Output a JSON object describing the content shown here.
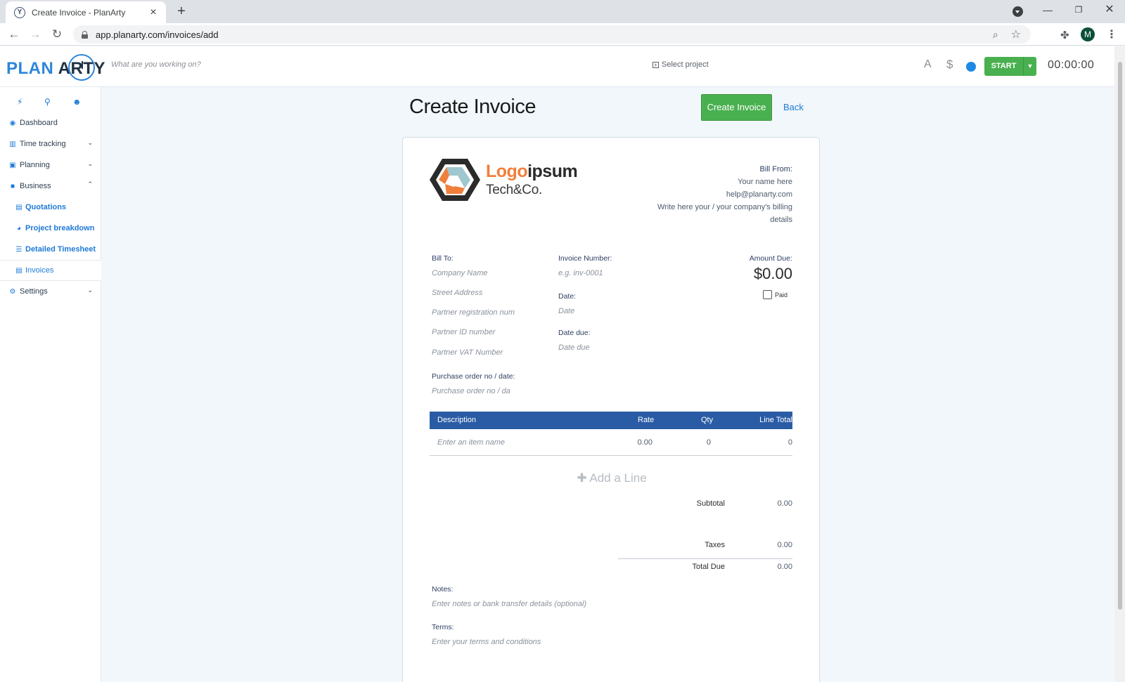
{
  "browser": {
    "tab_title": "Create Invoice - PlanArty",
    "favicon_letter": "Y",
    "url": "app.planarty.com/invoices/add",
    "profile_initial": "M"
  },
  "app": {
    "logo_plan": "PLAN",
    "logo_arty": "ARTY",
    "search_placeholder": "What are you working on?",
    "select_project": "Select project",
    "billable_icon_text": "A",
    "currency_icon_text": "$",
    "start_label": "START",
    "timer": "00:00:00"
  },
  "sidebar": {
    "quick_icons": [
      "bolt-icon",
      "search-icon",
      "user-cog-icon"
    ],
    "items": [
      {
        "label": "Dashboard",
        "icon": "dashboard-icon"
      },
      {
        "label": "Time tracking",
        "icon": "chart-icon"
      },
      {
        "label": "Planning",
        "icon": "calendar-icon"
      },
      {
        "label": "Business",
        "icon": "briefcase-icon"
      },
      {
        "label": "Quotations",
        "icon": "document-icon"
      },
      {
        "label": "Project breakdown",
        "icon": "pie-chart-icon"
      },
      {
        "label": "Detailed Timesheet",
        "icon": "list-icon"
      },
      {
        "label": "Invoices",
        "icon": "file-icon"
      },
      {
        "label": "Settings",
        "icon": "gear-icon"
      }
    ]
  },
  "page": {
    "title": "Create Invoice",
    "create_button": "Create Invoice",
    "back_link": "Back"
  },
  "invoice": {
    "logo_word_a": "Logo",
    "logo_word_b": "ipsum",
    "logo_sub": "Tech&Co.",
    "bill_from": {
      "label": "Bill From:",
      "name": "Your name here",
      "email": "help@planarty.com",
      "details": "Write here your / your company's billing details"
    },
    "bill_to": {
      "label": "Bill To:",
      "company": "Company Name",
      "street": "Street Address",
      "reg_num": "Partner registration num",
      "partner_id": "Partner ID number",
      "vat": "Partner VAT Number"
    },
    "invoice_number_label": "Invoice Number:",
    "invoice_number_placeholder": "e.g.   inv-0001",
    "date_label": "Date:",
    "date_placeholder": "Date",
    "date_due_label": "Date due:",
    "date_due_placeholder": "Date due",
    "amount_due_label": "Amount Due:",
    "amount_due_value": "$0.00",
    "paid_label": "Paid",
    "po_label": "Purchase order no / date:",
    "po_placeholder": "Purchase order no / date",
    "items_columns": {
      "description": "Description",
      "rate": "Rate",
      "qty": "Qty",
      "line_total": "Line Total"
    },
    "item_row": {
      "description": "Enter an item name",
      "rate": "0.00",
      "qty": "0",
      "line_total": "0"
    },
    "add_line": "Add a Line",
    "subtotal_label": "Subtotal",
    "subtotal_value": "0.00",
    "taxes_label": "Taxes",
    "taxes_value": "0.00",
    "total_due_label": "Total Due",
    "total_due_value": "0.00",
    "notes_label": "Notes:",
    "notes_placeholder": "Enter notes or bank transfer details (optional)",
    "terms_label": "Terms:",
    "terms_placeholder": "Enter your terms and conditions"
  }
}
